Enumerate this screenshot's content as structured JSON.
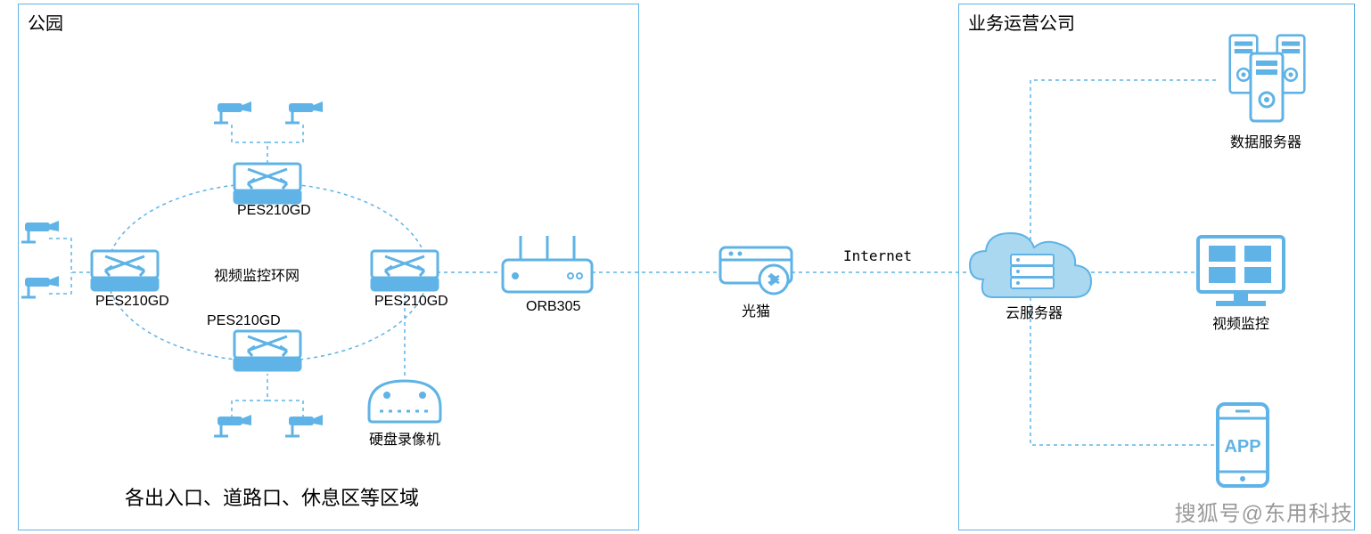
{
  "colors": {
    "line": "#5fb3e6",
    "iconFill": "#9fd4ef",
    "iconStroke": "#5fb3e6",
    "text": "#000000"
  },
  "panels": {
    "park": {
      "title": "公园"
    },
    "company": {
      "title": "业务运营公司"
    }
  },
  "labels": {
    "ring": "视频监控环网",
    "switchTop": "PES210GD",
    "switchLeft": "PES210GD",
    "switchBottom": "PES210GD",
    "switchRight": "PES210GD",
    "router": "ORB305",
    "nvr": "硬盘录像机",
    "modem": "光猫",
    "internet": "Internet",
    "cloud": "云服务器",
    "dataServer": "数据服务器",
    "videoMonitor": "视频监控",
    "app": "APP",
    "subtitle": "各出入口、道路口、休息区等区域"
  },
  "watermark": "搜狐号@东用科技"
}
